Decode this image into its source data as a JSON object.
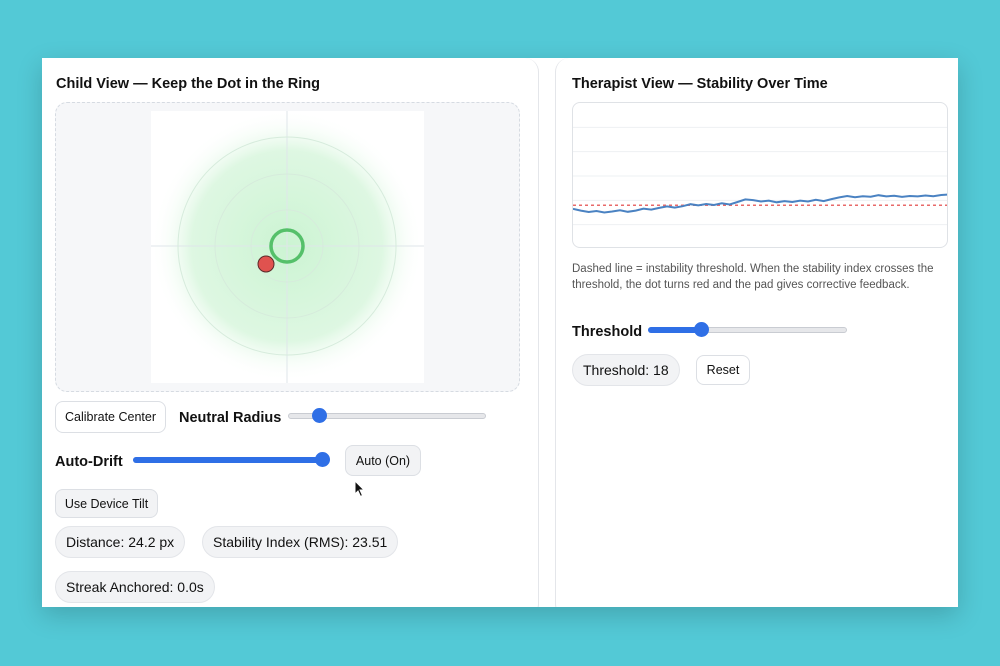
{
  "child_view": {
    "title": "Child View — Keep the Dot in the Ring",
    "calibrate_label": "Calibrate Center",
    "neutral_radius_label": "Neutral Radius",
    "neutral_radius_value": 0.13,
    "auto_drift_label": "Auto-Drift",
    "auto_drift_value": 1.0,
    "auto_button_label": "Auto (On)",
    "device_tilt_label": "Use Device Tilt",
    "distance_text": "Distance: 24.2 px",
    "stability_text": "Stability Index (RMS): 23.51",
    "streak_text": "Streak Anchored: 0.0s",
    "dot_color": "#e0524f",
    "ring_color": "#55c06a"
  },
  "therapist_view": {
    "title": "Therapist View — Stability Over Time",
    "description": "Dashed line = instability threshold. When the stability index crosses the threshold, the dot turns red and the pad gives corrective feedback.",
    "threshold_label": "Threshold",
    "threshold_slider_value": 0.25,
    "threshold_text": "Threshold: 18",
    "reset_label": "Reset",
    "line_color": "#4a82c2",
    "threshold_color": "#e86a6a"
  },
  "chart_data": {
    "type": "line",
    "title": "",
    "xlabel": "",
    "ylabel": "",
    "ylim": [
      0,
      60
    ],
    "threshold": 18,
    "series": [
      {
        "values": [
          16.5,
          15.8,
          15.2,
          15.6,
          15.0,
          15.4,
          15.9,
          15.3,
          15.8,
          16.6,
          16.2,
          16.9,
          17.5,
          17.0,
          17.6,
          18.4,
          17.9,
          18.5,
          18.1,
          18.8,
          18.3,
          19.3,
          20.4,
          20.1,
          19.5,
          19.9,
          19.2,
          19.7,
          19.3,
          19.9,
          19.5,
          20.2,
          19.7,
          20.5,
          21.2,
          21.8,
          21.3,
          21.7,
          21.5,
          22.1,
          21.6,
          21.9,
          21.4,
          21.8,
          21.6,
          22.0,
          21.7,
          22.2,
          22.4
        ]
      }
    ]
  }
}
